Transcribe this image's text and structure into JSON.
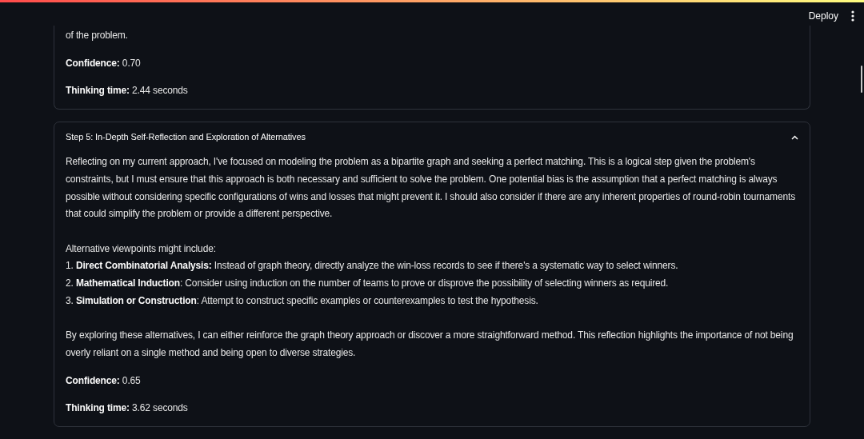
{
  "header": {
    "deploy_label": "Deploy"
  },
  "cards": [
    {
      "blocks": [
        {
          "kind": "paragraph",
          "text": "of the problem."
        }
      ],
      "confidence": "**Confidence:** 0.70",
      "thinking_time": "**Thinking time:** 2.44 seconds"
    },
    {
      "title": "Step 5: In-Depth Self-Reflection and Exploration of Alternatives",
      "expanded": true,
      "blocks": [
        {
          "kind": "paragraph",
          "text": "Reflecting on my current approach, I've focused on modeling the problem as a bipartite graph and seeking a perfect matching. This is a logical step given the problem's constraints, but I must ensure that this approach is both necessary and sufficient to solve the problem. One potential bias is the assumption that a perfect matching is always possible without considering specific configurations of wins and losses that might prevent it. I should also consider if there are any inherent properties of round-robin tournaments that could simplify the problem or provide a different perspective."
        },
        {
          "kind": "list",
          "intro": "Alternative viewpoints might include:",
          "items": [
            "1. **Direct Combinatorial Analysis:** Instead of graph theory, directly analyze the win-loss records to see if there's a systematic way to select winners.",
            "2. **Mathematical Induction**: Consider using induction on the number of teams to prove or disprove the possibility of selecting winners as required.",
            "3. **Simulation or Construction**: Attempt to construct specific examples or counterexamples to test the hypothesis."
          ]
        },
        {
          "kind": "paragraph",
          "text": "By exploring these alternatives, I can either reinforce the graph theory approach or discover a more straightforward method. This reflection highlights the importance of not being overly reliant on a single method and being open to diverse strategies."
        }
      ],
      "confidence": "**Confidence:** 0.65",
      "thinking_time": "**Thinking time:** 3.62 seconds"
    }
  ]
}
